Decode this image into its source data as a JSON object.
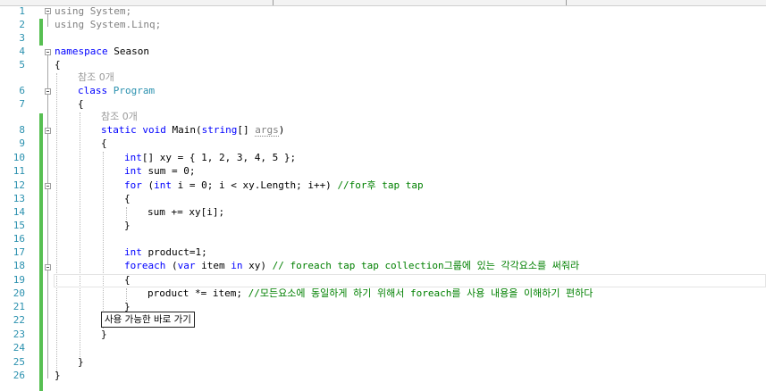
{
  "lines": {
    "l1": {
      "num": "1",
      "kw": "using",
      "rest": " System;"
    },
    "l2": {
      "num": "2",
      "kw": "using",
      "rest": " System.Linq;"
    },
    "l3": {
      "num": "3"
    },
    "l4": {
      "num": "4",
      "kw": "namespace",
      "rest": " Season"
    },
    "l5": {
      "num": "5",
      "text": "{"
    },
    "lens1": "참조 0개",
    "l6": {
      "num": "6",
      "kw": "class",
      "cls": "Program"
    },
    "l7": {
      "num": "7",
      "text": "{"
    },
    "lens2": "참조 0개",
    "l8": {
      "num": "8",
      "kw": "static void",
      "name": " Main(",
      "kw2": "string",
      "mid": "[] ",
      "param": "args",
      "end": ")"
    },
    "l9": {
      "num": "9",
      "text": "{"
    },
    "l10": {
      "num": "10",
      "kw": "int",
      "rest": "[] xy = { 1, 2, 3, 4, 5 };"
    },
    "l11": {
      "num": "11",
      "kw": "int",
      "rest": " sum = 0;"
    },
    "l12": {
      "num": "12",
      "kw": "for",
      "a": " (",
      "kw2": "int",
      "b": " i = 0; i < xy.Length; i++) ",
      "comment": "//for후 tap tap"
    },
    "l13": {
      "num": "13",
      "text": "{"
    },
    "l14": {
      "num": "14",
      "text": "sum += xy[i];"
    },
    "l15": {
      "num": "15",
      "text": "}"
    },
    "l16": {
      "num": "16"
    },
    "l17": {
      "num": "17",
      "kw": "int",
      "rest": " product=1;"
    },
    "l18": {
      "num": "18",
      "kw": "foreach",
      "a": " (",
      "kw2": "var",
      "b": " item ",
      "kw3": "in",
      "c": " xy) ",
      "comment": "// foreach tap tap collection그룹에 있는 각각요소를 써줘라"
    },
    "l19": {
      "num": "19",
      "text": "{"
    },
    "l20": {
      "num": "20",
      "text": "product *= item; ",
      "comment": "//모든요소에 동일하게 하기 위해서 foreach를 사용 내용을 이해하기 편하다"
    },
    "l21": {
      "num": "21",
      "text": "}"
    },
    "l22": {
      "num": "22"
    },
    "l23": {
      "num": "23",
      "text": "}"
    },
    "l24": {
      "num": "24"
    },
    "l25": {
      "num": "25",
      "text": "}"
    },
    "l26": {
      "num": "26",
      "text": "}"
    }
  },
  "tooltip": "사용 가능한 바로 가기",
  "colors": {
    "keyword": "#0000ff",
    "class": "#2b91af",
    "comment": "#008000",
    "change_bar": "#57bf52"
  }
}
